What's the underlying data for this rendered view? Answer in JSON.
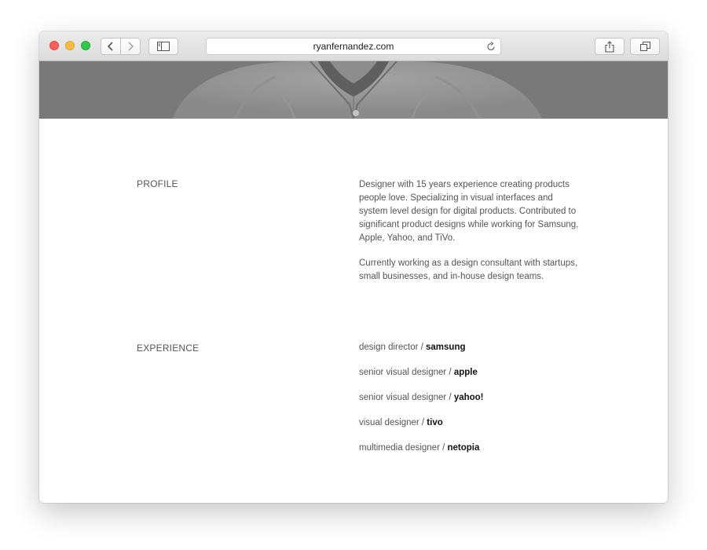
{
  "browser": {
    "url": "ryanfernandez.com",
    "icons": {
      "back": "chevron-left-icon",
      "forward": "chevron-right-icon",
      "sidebar": "sidebar-icon",
      "reload": "reload-icon",
      "share": "share-icon",
      "tabs": "tabs-icon"
    },
    "traffic_lights": {
      "close": "#fc605c",
      "minimize": "#fdbc40",
      "zoom": "#34c84a"
    }
  },
  "profile": {
    "label": "PROFILE",
    "paragraphs": [
      "Designer with 15 years experience creating products people love. Specializing in visual interfaces and system level design for digital products. Contributed to significant product designs while working for Samsung, Apple, Yahoo, and TiVo.",
      "Currently working as a design consultant with startups, small businesses, and in-house design teams."
    ]
  },
  "experience": {
    "label": "EXPERIENCE",
    "items": [
      {
        "role": "design director / ",
        "company": "samsung"
      },
      {
        "role": "senior visual designer / ",
        "company": "apple"
      },
      {
        "role": "senior visual designer / ",
        "company": "yahoo!"
      },
      {
        "role": "visual designer / ",
        "company": "tivo"
      },
      {
        "role": "multimedia designer / ",
        "company": "netopia"
      }
    ]
  }
}
